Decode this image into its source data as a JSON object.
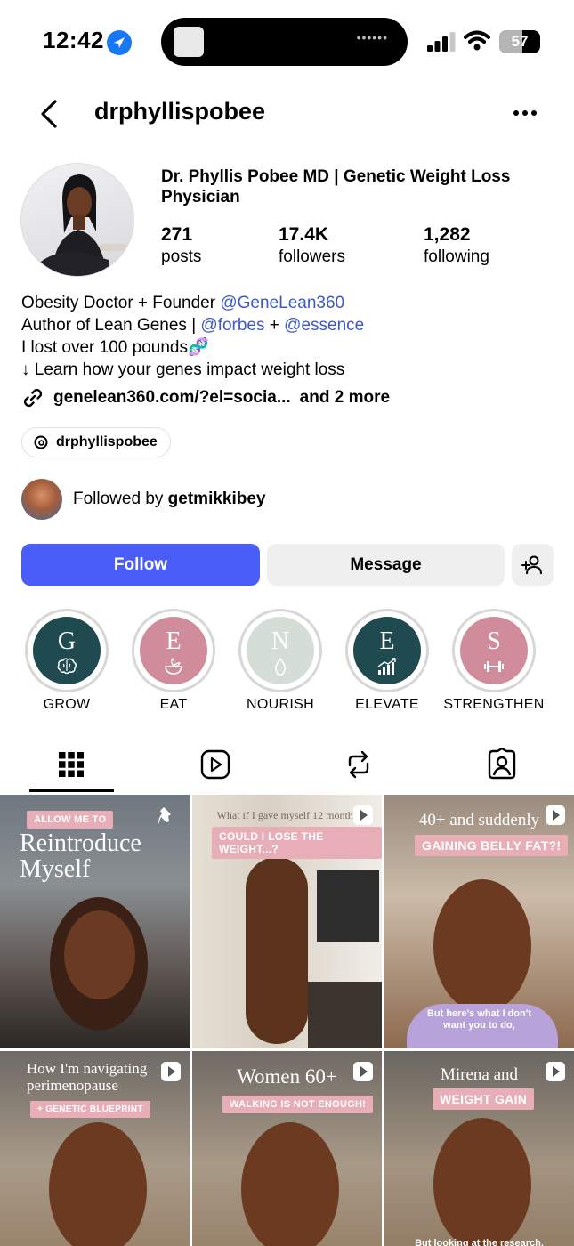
{
  "status_bar": {
    "time": "12:42",
    "battery": "57",
    "battery_level": 0.57
  },
  "header": {
    "username": "drphyllispobee"
  },
  "profile": {
    "name": "Dr. Phyllis Pobee MD | Genetic Weight Loss Physician",
    "stats": [
      {
        "value": "271",
        "label": "posts"
      },
      {
        "value": "17.4K",
        "label": "followers"
      },
      {
        "value": "1,282",
        "label": "following"
      }
    ],
    "bio": {
      "line1_text": "Obesity Doctor + Founder ",
      "line1_mention": "@GeneLean360",
      "line2_text": "Author of Lean Genes | ",
      "line2_mention1": "@forbes",
      "line2_plus": " + ",
      "line2_mention2": "@essence",
      "line3": "I lost over 100 pounds🧬",
      "line4": "↓ Learn how your genes impact weight loss"
    },
    "link": {
      "url": "genelean360.com/?el=socia...",
      "more": "and 2 more"
    },
    "threads_handle": "drphyllispobee",
    "followed_by_prefix": "Followed by ",
    "followed_by_user": "getmikkibey"
  },
  "actions": {
    "follow": "Follow",
    "message": "Message"
  },
  "highlights": [
    {
      "letter": "G",
      "label": "GROW",
      "color": "#1f4a4f",
      "icon": "brain-icon"
    },
    {
      "letter": "E",
      "label": "EAT",
      "color": "#d08c9a",
      "icon": "bowl-icon"
    },
    {
      "letter": "N",
      "label": "NOURISH",
      "color": "#d4ddd6",
      "icon": "drop-icon"
    },
    {
      "letter": "E",
      "label": "ELEVATE",
      "color": "#1f4a4f",
      "icon": "chart-icon"
    },
    {
      "letter": "S",
      "label": "STRENGTHEN",
      "color": "#d08c9a",
      "icon": "dumbbell-icon"
    }
  ],
  "tabs": [
    "grid-icon",
    "reels-icon",
    "reposts-icon",
    "tagged-icon"
  ],
  "posts": [
    {
      "tag": "ALLOW ME TO",
      "title": "Reintroduce Myself",
      "pinned": true
    },
    {
      "title": "What if I gave myself 12 months",
      "tag": "COULD I LOSE THE WEIGHT...?",
      "reel": true
    },
    {
      "title": "40+ and suddenly",
      "tag": "GAINING BELLY FAT?!",
      "subtitle": "But here's what I don't want you to do,",
      "reel": true
    },
    {
      "title": "How I'm navigating perimenopause",
      "tag": "+ GENETIC BLUEPRINT",
      "reel": true
    },
    {
      "title": "Women 60+",
      "tag": "WALKING IS NOT ENOUGH!",
      "reel": true
    },
    {
      "title": "Mirena and",
      "tag": "WEIGHT GAIN",
      "subtitle": "But looking at the research,",
      "reel": true
    }
  ]
}
